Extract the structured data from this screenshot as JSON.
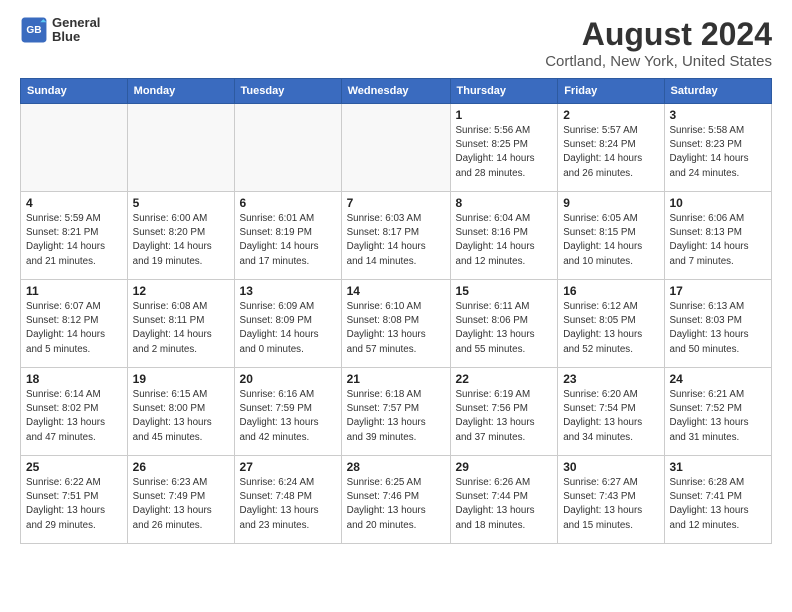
{
  "logo": {
    "line1": "General",
    "line2": "Blue"
  },
  "title": "August 2024",
  "location": "Cortland, New York, United States",
  "weekdays": [
    "Sunday",
    "Monday",
    "Tuesday",
    "Wednesday",
    "Thursday",
    "Friday",
    "Saturday"
  ],
  "weeks": [
    [
      {
        "day": "",
        "info": ""
      },
      {
        "day": "",
        "info": ""
      },
      {
        "day": "",
        "info": ""
      },
      {
        "day": "",
        "info": ""
      },
      {
        "day": "1",
        "info": "Sunrise: 5:56 AM\nSunset: 8:25 PM\nDaylight: 14 hours\nand 28 minutes."
      },
      {
        "day": "2",
        "info": "Sunrise: 5:57 AM\nSunset: 8:24 PM\nDaylight: 14 hours\nand 26 minutes."
      },
      {
        "day": "3",
        "info": "Sunrise: 5:58 AM\nSunset: 8:23 PM\nDaylight: 14 hours\nand 24 minutes."
      }
    ],
    [
      {
        "day": "4",
        "info": "Sunrise: 5:59 AM\nSunset: 8:21 PM\nDaylight: 14 hours\nand 21 minutes."
      },
      {
        "day": "5",
        "info": "Sunrise: 6:00 AM\nSunset: 8:20 PM\nDaylight: 14 hours\nand 19 minutes."
      },
      {
        "day": "6",
        "info": "Sunrise: 6:01 AM\nSunset: 8:19 PM\nDaylight: 14 hours\nand 17 minutes."
      },
      {
        "day": "7",
        "info": "Sunrise: 6:03 AM\nSunset: 8:17 PM\nDaylight: 14 hours\nand 14 minutes."
      },
      {
        "day": "8",
        "info": "Sunrise: 6:04 AM\nSunset: 8:16 PM\nDaylight: 14 hours\nand 12 minutes."
      },
      {
        "day": "9",
        "info": "Sunrise: 6:05 AM\nSunset: 8:15 PM\nDaylight: 14 hours\nand 10 minutes."
      },
      {
        "day": "10",
        "info": "Sunrise: 6:06 AM\nSunset: 8:13 PM\nDaylight: 14 hours\nand 7 minutes."
      }
    ],
    [
      {
        "day": "11",
        "info": "Sunrise: 6:07 AM\nSunset: 8:12 PM\nDaylight: 14 hours\nand 5 minutes."
      },
      {
        "day": "12",
        "info": "Sunrise: 6:08 AM\nSunset: 8:11 PM\nDaylight: 14 hours\nand 2 minutes."
      },
      {
        "day": "13",
        "info": "Sunrise: 6:09 AM\nSunset: 8:09 PM\nDaylight: 14 hours\nand 0 minutes."
      },
      {
        "day": "14",
        "info": "Sunrise: 6:10 AM\nSunset: 8:08 PM\nDaylight: 13 hours\nand 57 minutes."
      },
      {
        "day": "15",
        "info": "Sunrise: 6:11 AM\nSunset: 8:06 PM\nDaylight: 13 hours\nand 55 minutes."
      },
      {
        "day": "16",
        "info": "Sunrise: 6:12 AM\nSunset: 8:05 PM\nDaylight: 13 hours\nand 52 minutes."
      },
      {
        "day": "17",
        "info": "Sunrise: 6:13 AM\nSunset: 8:03 PM\nDaylight: 13 hours\nand 50 minutes."
      }
    ],
    [
      {
        "day": "18",
        "info": "Sunrise: 6:14 AM\nSunset: 8:02 PM\nDaylight: 13 hours\nand 47 minutes."
      },
      {
        "day": "19",
        "info": "Sunrise: 6:15 AM\nSunset: 8:00 PM\nDaylight: 13 hours\nand 45 minutes."
      },
      {
        "day": "20",
        "info": "Sunrise: 6:16 AM\nSunset: 7:59 PM\nDaylight: 13 hours\nand 42 minutes."
      },
      {
        "day": "21",
        "info": "Sunrise: 6:18 AM\nSunset: 7:57 PM\nDaylight: 13 hours\nand 39 minutes."
      },
      {
        "day": "22",
        "info": "Sunrise: 6:19 AM\nSunset: 7:56 PM\nDaylight: 13 hours\nand 37 minutes."
      },
      {
        "day": "23",
        "info": "Sunrise: 6:20 AM\nSunset: 7:54 PM\nDaylight: 13 hours\nand 34 minutes."
      },
      {
        "day": "24",
        "info": "Sunrise: 6:21 AM\nSunset: 7:52 PM\nDaylight: 13 hours\nand 31 minutes."
      }
    ],
    [
      {
        "day": "25",
        "info": "Sunrise: 6:22 AM\nSunset: 7:51 PM\nDaylight: 13 hours\nand 29 minutes."
      },
      {
        "day": "26",
        "info": "Sunrise: 6:23 AM\nSunset: 7:49 PM\nDaylight: 13 hours\nand 26 minutes."
      },
      {
        "day": "27",
        "info": "Sunrise: 6:24 AM\nSunset: 7:48 PM\nDaylight: 13 hours\nand 23 minutes."
      },
      {
        "day": "28",
        "info": "Sunrise: 6:25 AM\nSunset: 7:46 PM\nDaylight: 13 hours\nand 20 minutes."
      },
      {
        "day": "29",
        "info": "Sunrise: 6:26 AM\nSunset: 7:44 PM\nDaylight: 13 hours\nand 18 minutes."
      },
      {
        "day": "30",
        "info": "Sunrise: 6:27 AM\nSunset: 7:43 PM\nDaylight: 13 hours\nand 15 minutes."
      },
      {
        "day": "31",
        "info": "Sunrise: 6:28 AM\nSunset: 7:41 PM\nDaylight: 13 hours\nand 12 minutes."
      }
    ]
  ]
}
